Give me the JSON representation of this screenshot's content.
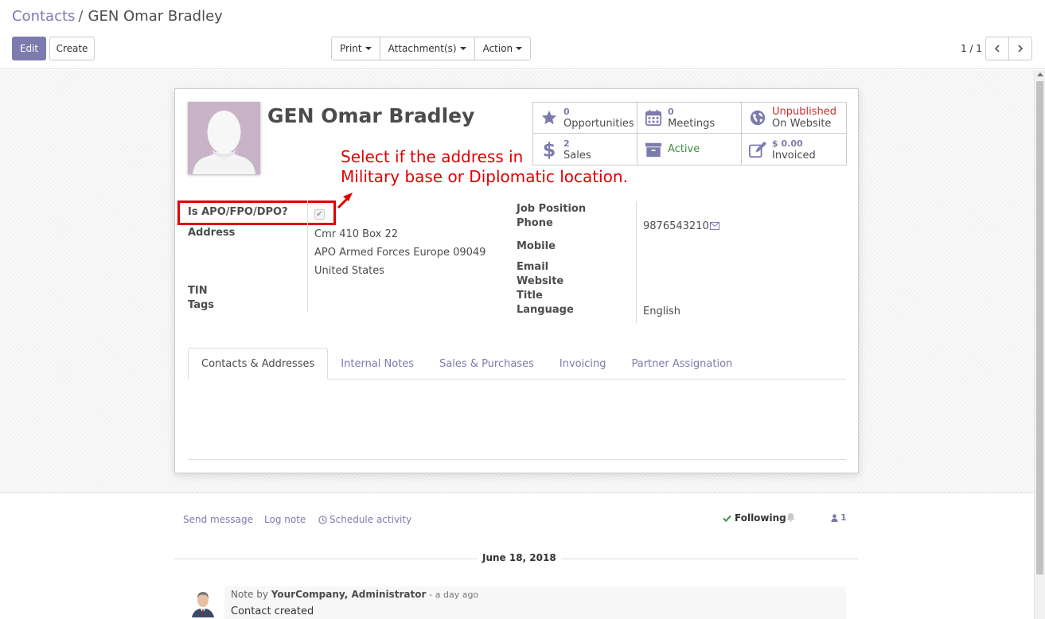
{
  "breadcrumb": {
    "parent": "Contacts",
    "separator": "/",
    "current": "GEN Omar Bradley"
  },
  "toolbar": {
    "edit_label": "Edit",
    "create_label": "Create",
    "print_label": "Print",
    "attachments_label": "Attachment(s)",
    "action_label": "Action"
  },
  "pager": {
    "value": "1 / 1"
  },
  "partner": {
    "name": "GEN Omar Bradley"
  },
  "stat_buttons": [
    {
      "icon": "star-icon",
      "count": "0",
      "label": "Opportunities"
    },
    {
      "icon": "calendar-icon",
      "count": "0",
      "label": "Meetings"
    },
    {
      "icon": "globe-icon",
      "status": "Unpublished",
      "label": "On Website"
    },
    {
      "icon": "dollar-icon",
      "count": "2",
      "label": "Sales"
    },
    {
      "icon": "archive-icon",
      "label": "Active"
    },
    {
      "icon": "pencil-square-icon",
      "count": "$ 0.00",
      "label": "Invoiced"
    }
  ],
  "annotation": {
    "line1": "Select if the address in",
    "line2": "Military base or Diplomatic location."
  },
  "fields_left": {
    "apo_label": "Is APO/FPO/DPO?",
    "apo_checked": true,
    "address_label": "Address",
    "address_line1": "Cmr 410 Box 22",
    "address_line2": "APO Armed Forces Europe 09049",
    "address_line3": "United States",
    "tin_label": "TIN",
    "tags_label": "Tags"
  },
  "fields_right": {
    "job_position_label": "Job Position",
    "phone_label": "Phone",
    "phone_value": "9876543210",
    "mobile_label": "Mobile",
    "email_label": "Email",
    "website_label": "Website",
    "title_label": "Title",
    "language_label": "Language",
    "language_value": "English"
  },
  "tabs": [
    {
      "label": "Contacts & Addresses",
      "active": true
    },
    {
      "label": "Internal Notes"
    },
    {
      "label": "Sales & Purchases"
    },
    {
      "label": "Invoicing"
    },
    {
      "label": "Partner Assignation"
    }
  ],
  "chatter": {
    "send_message": "Send message",
    "log_note": "Log note",
    "schedule_activity": "Schedule activity",
    "following": "Following",
    "followers_count": "1",
    "date": "June 18, 2018",
    "message": {
      "prefix": "Note by",
      "author": "YourCompany, Administrator",
      "time": "- a day ago",
      "body": "Contact created"
    }
  },
  "colors": {
    "primary": "#7c7bad",
    "annotation": "#e00000",
    "unpublished": "#c9302c",
    "active": "#3e8f3e"
  }
}
